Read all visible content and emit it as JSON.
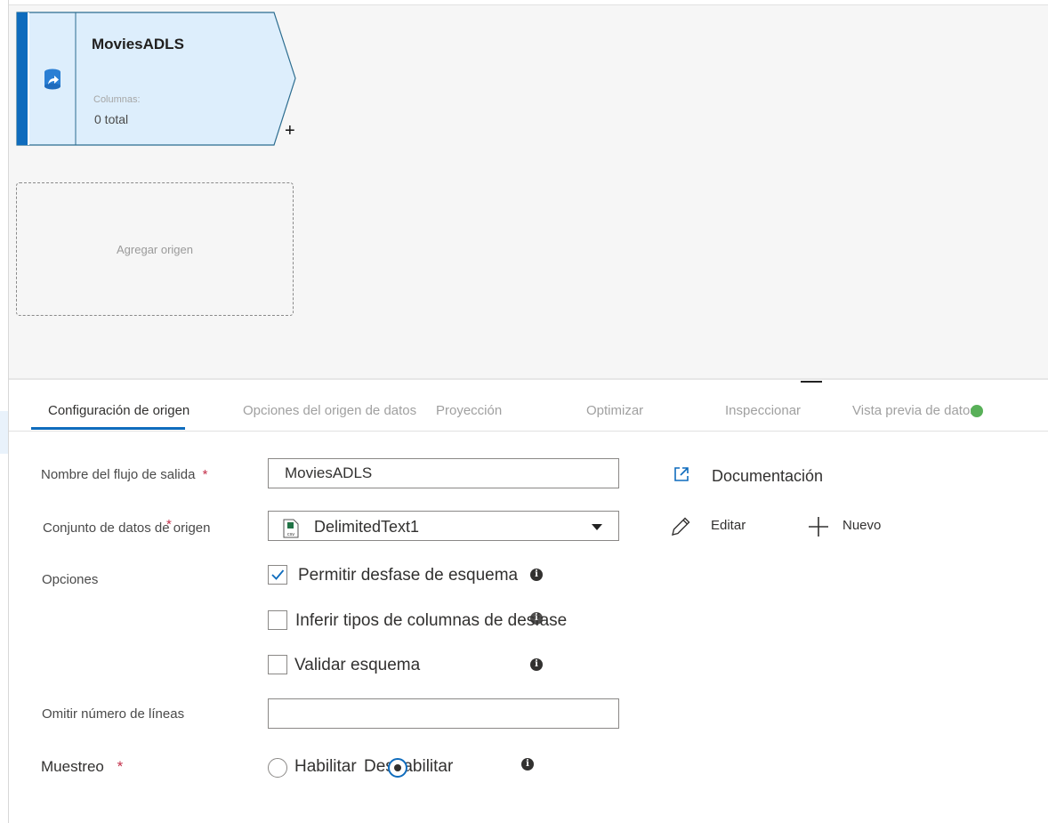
{
  "canvas": {
    "source_node": {
      "title": "MoviesADLS",
      "columns_label": "Columnas:",
      "columns_value": "0 total",
      "icon": "dataset-icon",
      "add_symbol": "+"
    },
    "add_source_label": "Agregar origen"
  },
  "tabs": [
    {
      "label": "Configuración de origen",
      "active": true
    },
    {
      "label": "Opciones del origen de datos",
      "active": false
    },
    {
      "label": "Proyección",
      "active": false
    },
    {
      "label": "Optimizar",
      "active": false
    },
    {
      "label": "Inspeccionar",
      "active": false
    },
    {
      "label": "Vista previa de datos",
      "active": false
    }
  ],
  "form": {
    "output_stream": {
      "label": "Nombre del flujo de salida",
      "required_mark": "*",
      "value": "MoviesADLS"
    },
    "source_dataset": {
      "label": "Conjunto de datos de origen",
      "required_mark": "*",
      "value": "DelimitedText1",
      "icon": "csv-file-icon"
    },
    "options": {
      "label": "Opciones",
      "items": [
        {
          "label": "Permitir desfase de esquema",
          "checked": true
        },
        {
          "label": "Inferir tipos de columnas de desfase",
          "checked": false
        },
        {
          "label": "Validar esquema",
          "checked": false
        }
      ]
    },
    "skip_lines": {
      "label": "Omitir número de líneas",
      "value": ""
    },
    "sampling": {
      "label": "Muestreo",
      "required_mark": "*",
      "options": [
        "Habilitar",
        "Deshabilitar"
      ],
      "selected": "Deshabilitar"
    }
  },
  "actions": {
    "documentation": "Documentación",
    "edit": "Editar",
    "new": "Nuevo"
  },
  "colors": {
    "accent": "#0f6cbd",
    "node_fill": "#ddeefc",
    "required": "#c4314b",
    "preview_status": "#58b058"
  }
}
